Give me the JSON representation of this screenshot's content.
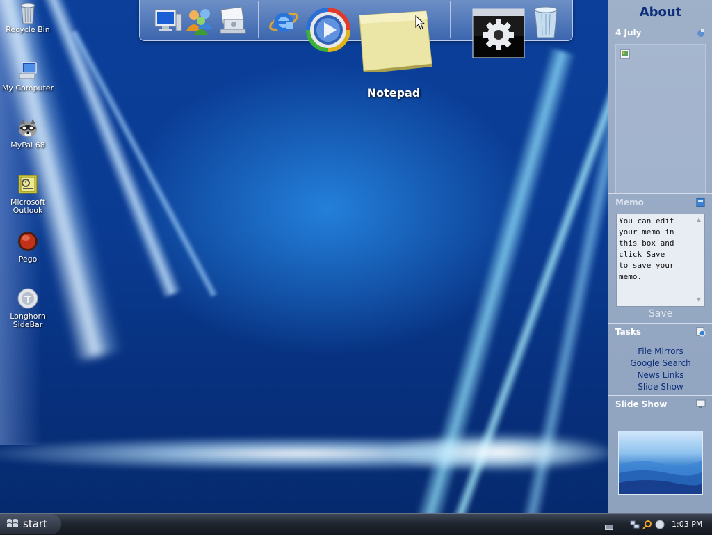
{
  "desktop_icons": [
    {
      "label": "Recycle Bin",
      "icon": "recycle-bin-icon"
    },
    {
      "label": "My Computer",
      "icon": "computer-icon"
    },
    {
      "label": "MyPal 68",
      "icon": "raccoon-browser-icon"
    },
    {
      "label": "Microsoft Outlook",
      "icon": "outlook-icon"
    },
    {
      "label": "Pego",
      "icon": "pego-icon"
    },
    {
      "label": "Longhorn SideBar",
      "icon": "sidebar-app-icon"
    }
  ],
  "dock": {
    "items": [
      "computer-icon",
      "users-icon",
      "network-icon",
      "internet-explorer-icon",
      "media-player-icon",
      "notepad-icon",
      "settings-window-icon",
      "recycle-bin-icon"
    ],
    "hover_label": "Notepad"
  },
  "sidebar": {
    "title": "About",
    "date_section": {
      "label": "4 July"
    },
    "memo": {
      "label": "Memo",
      "text": "You can edit\nyour memo in\nthis box and\nclick Save\nto save your\nmemo.",
      "save_label": "Save"
    },
    "tasks": {
      "label": "Tasks",
      "links": [
        "File Mirrors",
        "Google Search",
        "News Links",
        "Slide Show"
      ]
    },
    "slideshow": {
      "label": "Slide Show"
    }
  },
  "taskbar": {
    "start_label": "start",
    "clock": "1:03 PM"
  },
  "colors": {
    "desktop_blue": "#0a3b92",
    "sidebar_bg": "#9fb0c9",
    "link_color": "#0e2f7a",
    "taskbar_dark": "#20262f"
  }
}
